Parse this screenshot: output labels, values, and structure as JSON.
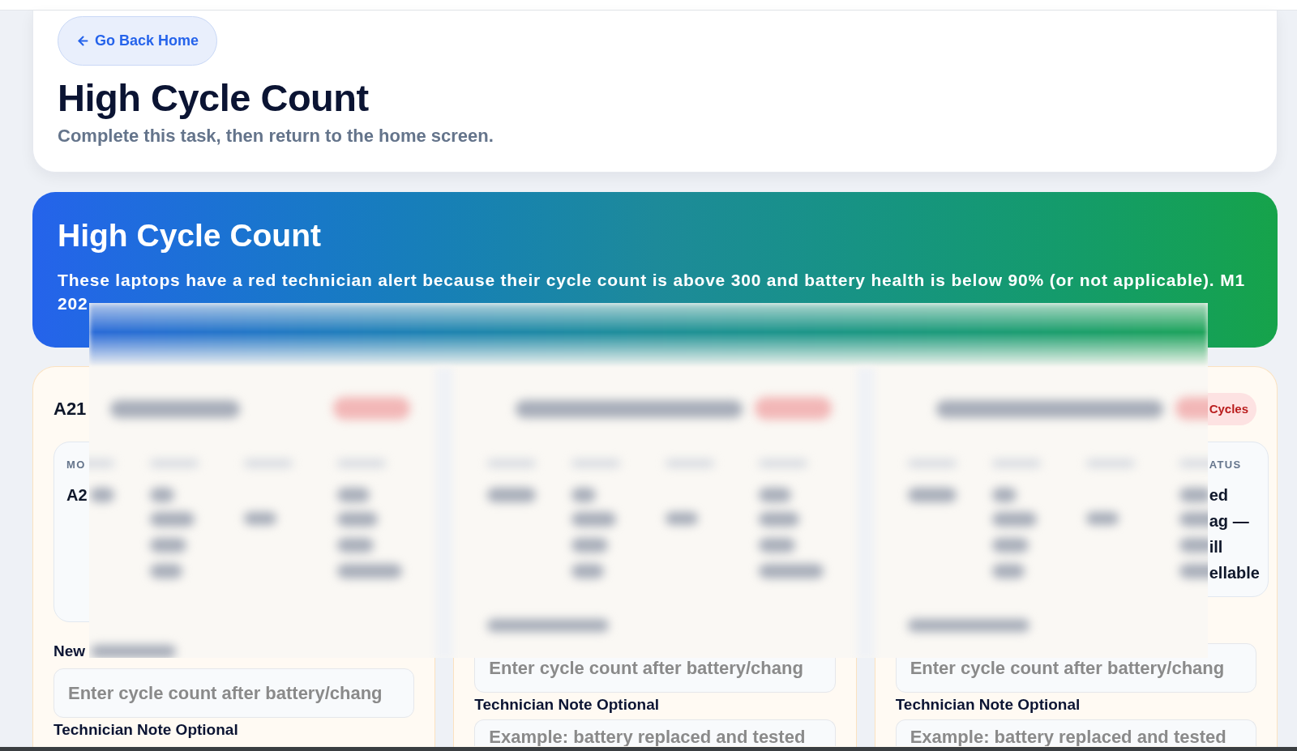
{
  "back_button": {
    "label": "Go Back Home"
  },
  "header": {
    "title": "High Cycle Count",
    "subtitle": "Complete this task, then return to the home screen."
  },
  "banner": {
    "title": "High Cycle Count",
    "description": "These laptops have a red technician alert because their cycle count is above 300 and battery health is below 90% (or not applicable). M1\n202"
  },
  "cards": [
    {
      "title": "A21",
      "details": {
        "kind": "leading",
        "label": "MO",
        "lines": [
          "A2"
        ]
      },
      "input_label": "New",
      "cycle_input": {
        "placeholder": "Enter cycle count after battery/chang"
      },
      "note_label": "Technician Note Optional"
    },
    {
      "cycle_input": {
        "placeholder": "Enter cycle count after battery/chang"
      },
      "note_label": "Technician Note Optional",
      "note_input": {
        "placeholder": "Example: battery replaced and tested"
      }
    },
    {
      "badge": "Cycles",
      "details": {
        "kind": "trailing",
        "label": "ATUS",
        "lines": [
          "ed",
          "ag —",
          "ill",
          "ellable"
        ]
      },
      "cycle_input": {
        "placeholder": "Enter cycle count after battery/chang"
      },
      "note_label": "Technician Note Optional",
      "note_input": {
        "placeholder": "Example: battery replaced and tested"
      }
    }
  ]
}
